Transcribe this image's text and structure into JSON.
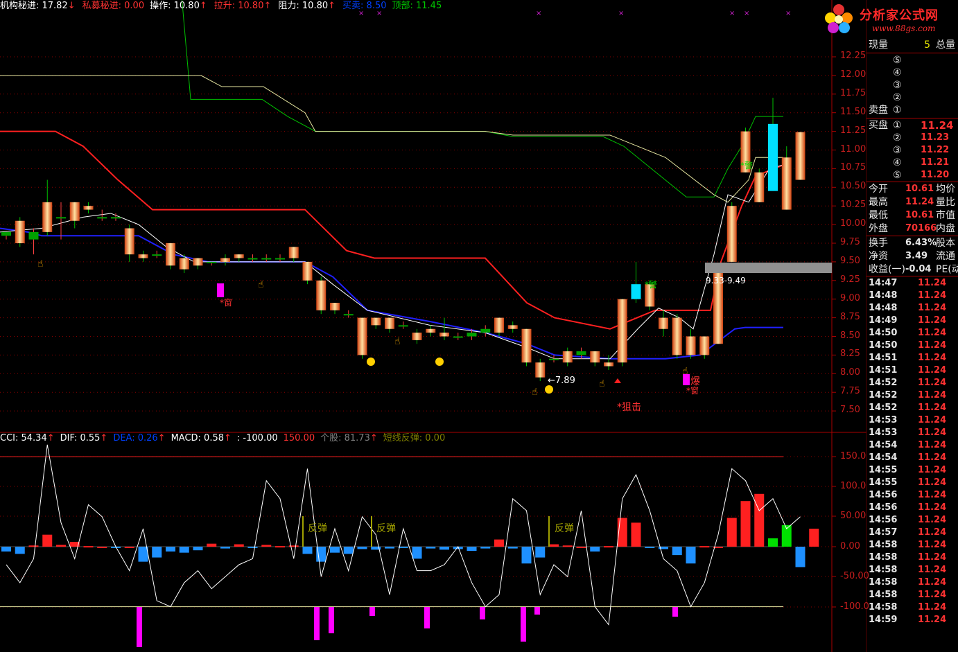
{
  "top_legend": [
    {
      "label": "机构秘进: ",
      "value": "17.82",
      "arrow": "↓",
      "color": "#ffffff"
    },
    {
      "label": "私募秘进: ",
      "value": "0.00",
      "arrow": "",
      "color": "#ff3232"
    },
    {
      "label": "操作: ",
      "value": "10.80",
      "arrow": "↑",
      "color": "#ffffff"
    },
    {
      "label": "拉升: ",
      "value": "10.80",
      "arrow": "↑",
      "color": "#ff3232"
    },
    {
      "label": "阻力: ",
      "value": "10.80",
      "arrow": "↑",
      "color": "#ffffff"
    },
    {
      "label": "买卖: ",
      "value": "8.50",
      "arrow": "",
      "color": "#0040ff"
    },
    {
      "label": "顶部: ",
      "value": "11.45",
      "arrow": "",
      "color": "#00c800"
    }
  ],
  "sub_legend": [
    {
      "label": "CCI: ",
      "value": "54.34",
      "arrow": "↑",
      "color": "#ffffff"
    },
    {
      "label": "DIF: ",
      "value": "0.55",
      "arrow": "↑",
      "color": "#ffffff"
    },
    {
      "label": "DEA: ",
      "value": "0.26",
      "arrow": "↑",
      "color": "#0040ff"
    },
    {
      "label": "MACD: ",
      "value": "0.58",
      "arrow": "↑",
      "color": "#ffffff"
    },
    {
      "label": ": ",
      "value": "-100.00",
      "arrow": "",
      "color": "#ffffff"
    },
    {
      "label": "",
      "value": "150.00",
      "arrow": "",
      "color": "#ff3232"
    },
    {
      "label": "个股: ",
      "value": "81.73",
      "arrow": "↑",
      "color": "#808080"
    },
    {
      "label": "短线反弹: ",
      "value": "0.00",
      "arrow": "",
      "color": "#808000"
    }
  ],
  "logo": {
    "title": "分析家公式网",
    "url": "www.88gs.com"
  },
  "price_axis": [
    "12.25",
    "12.00",
    "11.75",
    "11.50",
    "11.25",
    "11.00",
    "10.75",
    "10.50",
    "10.25",
    "10.00",
    "9.75",
    "9.50",
    "9.25",
    "9.00",
    "8.75",
    "8.50",
    "8.25",
    "8.00",
    "7.75",
    "7.50"
  ],
  "sub_axis": [
    "150.0",
    "100.0",
    "50.00",
    "0.00",
    "-50.00",
    "-100.0"
  ],
  "annotations": {
    "low_label": "←7.89",
    "range_label": "9.33-9.49",
    "sniper": "*狙击",
    "warn1": "*警",
    "warn2": "*警",
    "chuang1": "*窗",
    "chuang2": "*窗",
    "bao": "爆",
    "rebound": "反弹"
  },
  "quote": {
    "volume_label": "现量",
    "volume_value": "5",
    "total_label": "总量",
    "sell_label": "卖盘",
    "buy_label": "买盘",
    "sell_levels": [
      "⑤",
      "④",
      "③",
      "②",
      "①"
    ],
    "buy_levels": [
      {
        "n": "①",
        "price": "11.24"
      },
      {
        "n": "②",
        "price": "11.23"
      },
      {
        "n": "③",
        "price": "11.22"
      },
      {
        "n": "④",
        "price": "11.21"
      },
      {
        "n": "⑤",
        "price": "11.20"
      }
    ],
    "stats": [
      {
        "label": "今开",
        "value": "10.61",
        "extra": "均价",
        "color": "#ff3232"
      },
      {
        "label": "最高",
        "value": "11.24",
        "extra": "量比",
        "color": "#ff3232"
      },
      {
        "label": "最低",
        "value": "10.61",
        "extra": "市值",
        "color": "#ff3232"
      },
      {
        "label": "外盘",
        "value": "70166",
        "extra": "内盘",
        "color": "#ff3232"
      }
    ],
    "stats2": [
      {
        "label": "换手",
        "value": "6.43%",
        "extra": "股本",
        "color": "#e6e6e6"
      },
      {
        "label": "净资",
        "value": "3.49",
        "extra": "流通",
        "color": "#e6e6e6"
      },
      {
        "label": "收益(一)",
        "value": "-0.04",
        "extra": "PE(动",
        "color": "#e6e6e6"
      }
    ],
    "trades": [
      {
        "t": "14:47",
        "p": "11.24"
      },
      {
        "t": "14:48",
        "p": "11.24"
      },
      {
        "t": "14:48",
        "p": "11.24"
      },
      {
        "t": "14:49",
        "p": "11.24"
      },
      {
        "t": "14:50",
        "p": "11.24"
      },
      {
        "t": "14:50",
        "p": "11.24"
      },
      {
        "t": "14:51",
        "p": "11.24"
      },
      {
        "t": "14:51",
        "p": "11.24"
      },
      {
        "t": "14:52",
        "p": "11.24"
      },
      {
        "t": "14:52",
        "p": "11.24"
      },
      {
        "t": "14:52",
        "p": "11.24"
      },
      {
        "t": "14:53",
        "p": "11.24"
      },
      {
        "t": "14:53",
        "p": "11.24"
      },
      {
        "t": "14:54",
        "p": "11.24"
      },
      {
        "t": "14:54",
        "p": "11.24"
      },
      {
        "t": "14:55",
        "p": "11.24"
      },
      {
        "t": "14:55",
        "p": "11.24"
      },
      {
        "t": "14:56",
        "p": "11.24"
      },
      {
        "t": "14:56",
        "p": "11.24"
      },
      {
        "t": "14:56",
        "p": "11.24"
      },
      {
        "t": "14:57",
        "p": "11.24"
      },
      {
        "t": "14:58",
        "p": "11.24"
      },
      {
        "t": "14:58",
        "p": "11.24"
      },
      {
        "t": "14:58",
        "p": "11.24"
      },
      {
        "t": "14:58",
        "p": "11.24"
      },
      {
        "t": "14:58",
        "p": "11.24"
      },
      {
        "t": "14:58",
        "p": "11.24"
      },
      {
        "t": "14:59",
        "p": "11.24"
      }
    ]
  },
  "chart_data": {
    "type": "candlestick",
    "ylim": [
      7.4,
      12.4
    ],
    "candles": [
      {
        "o": 9.85,
        "h": 9.9,
        "l": 9.8,
        "c": 9.9
      },
      {
        "o": 10.05,
        "h": 10.1,
        "l": 9.7,
        "c": 9.75
      },
      {
        "o": 9.8,
        "h": 9.95,
        "l": 9.6,
        "c": 9.9
      },
      {
        "o": 10.3,
        "h": 10.6,
        "l": 9.85,
        "c": 9.9
      },
      {
        "o": 10.1,
        "h": 10.3,
        "l": 9.8,
        "c": 10.1
      },
      {
        "o": 10.3,
        "h": 10.3,
        "l": 9.95,
        "c": 10.05
      },
      {
        "o": 10.25,
        "h": 10.3,
        "l": 10.15,
        "c": 10.2
      },
      {
        "o": 10.1,
        "h": 10.2,
        "l": 10.05,
        "c": 10.1
      },
      {
        "o": 10.1,
        "h": 10.15,
        "l": 10.05,
        "c": 10.1
      },
      {
        "o": 9.95,
        "h": 10.0,
        "l": 9.5,
        "c": 9.6
      },
      {
        "o": 9.6,
        "h": 9.65,
        "l": 9.5,
        "c": 9.55
      },
      {
        "o": 9.6,
        "h": 9.65,
        "l": 9.55,
        "c": 9.6
      },
      {
        "o": 9.75,
        "h": 9.75,
        "l": 9.4,
        "c": 9.45
      },
      {
        "o": 9.55,
        "h": 9.6,
        "l": 9.35,
        "c": 9.4
      },
      {
        "o": 9.55,
        "h": 9.55,
        "l": 9.4,
        "c": 9.45
      },
      {
        "o": 9.5,
        "h": 9.5,
        "l": 9.45,
        "c": 9.5
      },
      {
        "o": 9.55,
        "h": 9.6,
        "l": 9.45,
        "c": 9.5
      },
      {
        "o": 9.6,
        "h": 9.6,
        "l": 9.5,
        "c": 9.55
      },
      {
        "o": 9.55,
        "h": 9.6,
        "l": 9.5,
        "c": 9.55
      },
      {
        "o": 9.55,
        "h": 9.6,
        "l": 9.5,
        "c": 9.55
      },
      {
        "o": 9.55,
        "h": 9.6,
        "l": 9.5,
        "c": 9.55
      },
      {
        "o": 9.7,
        "h": 9.7,
        "l": 9.5,
        "c": 9.55
      },
      {
        "o": 9.5,
        "h": 9.5,
        "l": 9.2,
        "c": 9.25
      },
      {
        "o": 9.25,
        "h": 9.3,
        "l": 8.8,
        "c": 8.85
      },
      {
        "o": 8.95,
        "h": 8.95,
        "l": 8.8,
        "c": 8.85
      },
      {
        "o": 8.8,
        "h": 8.85,
        "l": 8.75,
        "c": 8.8
      },
      {
        "o": 8.75,
        "h": 8.75,
        "l": 8.2,
        "c": 8.25
      },
      {
        "o": 8.75,
        "h": 8.75,
        "l": 8.6,
        "c": 8.65
      },
      {
        "o": 8.75,
        "h": 8.75,
        "l": 8.55,
        "c": 8.6
      },
      {
        "o": 8.65,
        "h": 8.7,
        "l": 8.6,
        "c": 8.65
      },
      {
        "o": 8.55,
        "h": 8.6,
        "l": 8.4,
        "c": 8.45
      },
      {
        "o": 8.6,
        "h": 8.65,
        "l": 8.5,
        "c": 8.55
      },
      {
        "o": 8.55,
        "h": 8.75,
        "l": 8.45,
        "c": 8.5
      },
      {
        "o": 8.5,
        "h": 8.55,
        "l": 8.45,
        "c": 8.5
      },
      {
        "o": 8.5,
        "h": 8.6,
        "l": 8.45,
        "c": 8.55
      },
      {
        "o": 8.55,
        "h": 8.65,
        "l": 8.5,
        "c": 8.6
      },
      {
        "o": 8.75,
        "h": 8.75,
        "l": 8.5,
        "c": 8.55
      },
      {
        "o": 8.65,
        "h": 8.7,
        "l": 8.55,
        "c": 8.6
      },
      {
        "o": 8.6,
        "h": 8.6,
        "l": 8.1,
        "c": 8.15
      },
      {
        "o": 8.15,
        "h": 8.2,
        "l": 7.9,
        "c": 7.95
      },
      {
        "o": 8.2,
        "h": 8.25,
        "l": 8.15,
        "c": 8.2
      },
      {
        "o": 8.3,
        "h": 8.35,
        "l": 8.1,
        "c": 8.15
      },
      {
        "o": 8.25,
        "h": 8.35,
        "l": 8.2,
        "c": 8.3
      },
      {
        "o": 8.3,
        "h": 8.3,
        "l": 8.1,
        "c": 8.15
      },
      {
        "o": 8.15,
        "h": 8.25,
        "l": 8.05,
        "c": 8.1
      },
      {
        "o": 9.0,
        "h": 9.0,
        "l": 8.1,
        "c": 8.15
      },
      {
        "o": 9.2,
        "h": 9.5,
        "l": 8.95,
        "c": 9.0
      },
      {
        "o": 9.2,
        "h": 9.25,
        "l": 8.85,
        "c": 8.9
      },
      {
        "o": 8.75,
        "h": 8.85,
        "l": 8.5,
        "c": 8.6
      },
      {
        "o": 8.75,
        "h": 8.8,
        "l": 8.2,
        "c": 8.25
      },
      {
        "o": 8.5,
        "h": 8.6,
        "l": 8.2,
        "c": 8.25
      },
      {
        "o": 8.5,
        "h": 8.5,
        "l": 8.2,
        "c": 8.25
      },
      {
        "o": 9.35,
        "h": 9.4,
        "l": 8.4,
        "c": 8.4
      },
      {
        "o": 10.25,
        "h": 10.3,
        "l": 9.5,
        "c": 9.5
      },
      {
        "o": 11.25,
        "h": 11.3,
        "l": 10.7,
        "c": 10.7
      },
      {
        "o": 10.7,
        "h": 10.75,
        "l": 10.3,
        "c": 10.3
      },
      {
        "o": 11.35,
        "h": 11.7,
        "l": 10.45,
        "c": 10.45
      },
      {
        "o": 10.9,
        "h": 11.05,
        "l": 10.2,
        "c": 10.2
      },
      {
        "o": 11.24,
        "h": 11.24,
        "l": 10.6,
        "c": 10.6
      }
    ]
  }
}
